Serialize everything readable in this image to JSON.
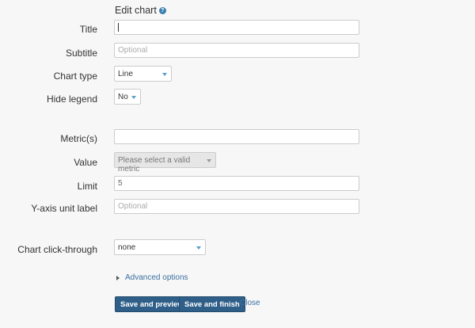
{
  "header": {
    "title": "Edit chart",
    "help_glyph": "?"
  },
  "form": {
    "title": {
      "label": "Title",
      "value": ""
    },
    "subtitle": {
      "label": "Subtitle",
      "placeholder": "Optional"
    },
    "chart_type": {
      "label": "Chart type",
      "selected": "Line"
    },
    "hide_legend": {
      "label": "Hide legend",
      "selected": "No"
    },
    "metrics": {
      "label": "Metric(s)",
      "value": ""
    },
    "value": {
      "label": "Value",
      "selected": "Please select a valid metric"
    },
    "limit": {
      "label": "Limit",
      "value": "5"
    },
    "y_axis_unit": {
      "label": "Y-axis unit label",
      "placeholder": "Optional"
    },
    "click_through": {
      "label": "Chart click-through",
      "selected": "none"
    }
  },
  "advanced": {
    "label": "Advanced options"
  },
  "actions": {
    "save_preview": "Save and preview",
    "save_finish": "Save and finish",
    "close": "Close"
  },
  "colors": {
    "primary_button": "#2f5f88",
    "link": "#3a6fa0",
    "select_arrow": "#5a9ec9"
  }
}
